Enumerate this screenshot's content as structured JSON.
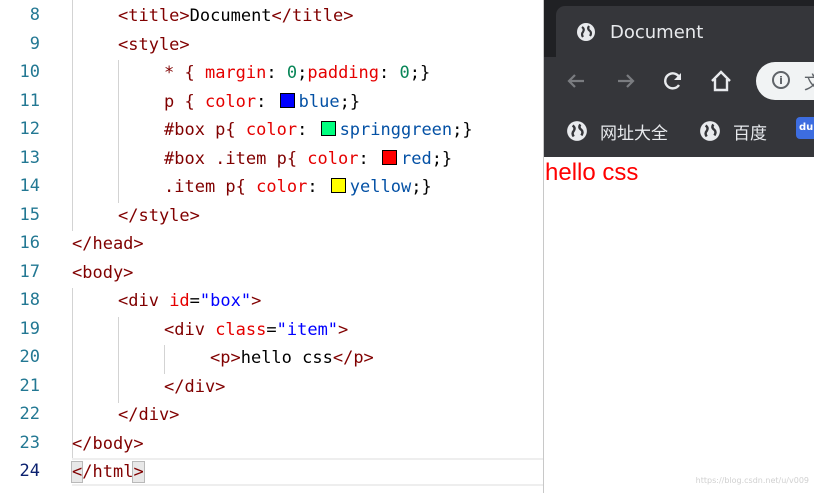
{
  "editor": {
    "line_numbers": [
      "8",
      "9",
      "10",
      "11",
      "12",
      "13",
      "14",
      "15",
      "16",
      "17",
      "18",
      "19",
      "20",
      "21",
      "22",
      "23",
      "24"
    ],
    "active_line": "24",
    "code": {
      "l8_open": "<title>",
      "l8_text": "Document",
      "l8_close": "</title>",
      "l9_open": "<style>",
      "l10_sel": "* { ",
      "l10_p1": "margin",
      "l10_c1": ": ",
      "l10_n1": "0",
      "l10_s1": ";",
      "l10_p2": "padding",
      "l10_c2": ": ",
      "l10_n2": "0",
      "l10_end": ";}",
      "l11_sel": "p { ",
      "l11_prop": "color",
      "l11_colon": ": ",
      "l11_val": "blue",
      "l11_end": ";}",
      "l12_sel": "#box p{ ",
      "l12_prop": "color",
      "l12_colon": ": ",
      "l12_val": "springgreen",
      "l12_end": ";}",
      "l13_sel": "#box .item p{ ",
      "l13_prop": "color",
      "l13_colon": ": ",
      "l13_val": "red",
      "l13_end": ";}",
      "l14_sel": ".item p{ ",
      "l14_prop": "color",
      "l14_colon": ": ",
      "l14_val": "yellow",
      "l14_end": ";}",
      "l15_close": "</style>",
      "l16_close": "</head>",
      "l17_open": "<body>",
      "l18_open": "<div ",
      "l18_attr": "id",
      "l18_eq": "=",
      "l18_str": "\"box\"",
      "l18_gt": ">",
      "l19_open": "<div ",
      "l19_attr": "class",
      "l19_eq": "=",
      "l19_str": "\"item\"",
      "l19_gt": ">",
      "l20_open": "<p>",
      "l20_text": "hello css",
      "l20_close": "</p>",
      "l21_close": "</div>",
      "l22_close": "</div>",
      "l23_close": "</body>",
      "l24_lt": "<",
      "l24_mid": "/html",
      "l24_gt": ">"
    },
    "swatches": {
      "blue": "#0000ff",
      "springgreen": "#00ff7f",
      "red": "#ff0000",
      "yellow": "#ffff00"
    }
  },
  "browser": {
    "tab_title": "Document",
    "tab_icon": "globe-icon",
    "omnibox_text": "文",
    "bookmarks": [
      {
        "label": "网址大全",
        "icon": "globe-icon"
      },
      {
        "label": "百度",
        "icon": "globe-icon"
      }
    ],
    "baidu_icon_text": "du",
    "page_text": "hello css",
    "page_text_color": "#ff0000",
    "watermark": "https://blog.csdn.net/u/v009"
  }
}
